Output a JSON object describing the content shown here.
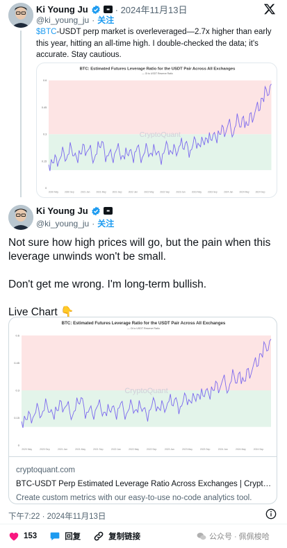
{
  "tweet1": {
    "author_name": "Ki Young Ju",
    "handle": "@ki_young_ju",
    "follow_label": "关注",
    "date": "· 2024年11月13日",
    "cashtag": "$BTC",
    "text": "-USDT perp market is overleveraged—2.7x higher than early this year, hitting an all-time high. I double-checked the data; it's accurate. Stay cautious."
  },
  "tweet2": {
    "author_name": "Ki Young Ju",
    "handle": "@ki_young_ju",
    "follow_label": "关注",
    "paragraphs": [
      "Not sure how high prices will go, but the pain when this leverage unwinds won't be small.",
      "Don't get me wrong. I'm long-term bullish.",
      "Live Chart 👇"
    ],
    "card": {
      "domain": "cryptoquant.com",
      "title": "BTC-USDT Perp Estimated Leverage Ratio Across Exchanges | CryptoQuant",
      "description": "Create custom metrics with our easy-to-use no-code analytics tool."
    },
    "timestamp": "下午7:22 · 2024年11月13日",
    "actions": {
      "like_count": "153",
      "reply_label": "回复",
      "copy_link_label": "复制链接"
    }
  },
  "watermark": "公众号 · 佩佩梭哈",
  "colors": {
    "accent": "#1d9bf0",
    "like": "#f91880",
    "series": "#7b68ee",
    "band_high": "#fde4e4",
    "band_low": "#e3f4ea"
  },
  "chart_data": [
    {
      "type": "line",
      "title": "BTC: Estimated Futures Leverage Ratio for the USDT Pair Across All Exchanges",
      "legend": [
        "Oi to USDT Reserve Ratio"
      ],
      "watermark": "CryptoQuant",
      "y_ticks": [
        "0.6",
        "0.45",
        "0.3",
        "0.15",
        "0"
      ],
      "x_ticks": [
        "2020 May",
        "2020 Sep",
        "2021 Jan",
        "2021 May",
        "2021 Sep",
        "2022 Jan",
        "2022 May",
        "2022 Sep",
        "2023 Jan",
        "2023 May",
        "2023 Sep",
        "2024 Jan",
        "2024 May",
        "2024 Sep"
      ],
      "ylim": [
        0,
        0.6
      ],
      "bands": [
        {
          "from": 0.3,
          "to": 0.6,
          "color": "red"
        },
        {
          "from": 0.1,
          "to": 0.3,
          "color": "green"
        }
      ],
      "series": [
        {
          "name": "Oi to USDT Reserve Ratio",
          "values": [
            0.13,
            0.16,
            0.14,
            0.17,
            0.15,
            0.18,
            0.2,
            0.16,
            0.19,
            0.22,
            0.18,
            0.17,
            0.21,
            0.19,
            0.24,
            0.2,
            0.22,
            0.18,
            0.16,
            0.19,
            0.23,
            0.26,
            0.21,
            0.18,
            0.2,
            0.17,
            0.19,
            0.22,
            0.2,
            0.18,
            0.16,
            0.19,
            0.21,
            0.18,
            0.2,
            0.23,
            0.19,
            0.17,
            0.2,
            0.22,
            0.19,
            0.18,
            0.21,
            0.2,
            0.17,
            0.19,
            0.22,
            0.24,
            0.21,
            0.19,
            0.22,
            0.2,
            0.24,
            0.22,
            0.25,
            0.23,
            0.21,
            0.24,
            0.27,
            0.25,
            0.23,
            0.26,
            0.28,
            0.25,
            0.27,
            0.3,
            0.28,
            0.32,
            0.3,
            0.34,
            0.31,
            0.36,
            0.33,
            0.3,
            0.35,
            0.38,
            0.34,
            0.4,
            0.37,
            0.35,
            0.42,
            0.39,
            0.45,
            0.43,
            0.5,
            0.48,
            0.55,
            0.52,
            0.58
          ]
        }
      ]
    }
  ]
}
